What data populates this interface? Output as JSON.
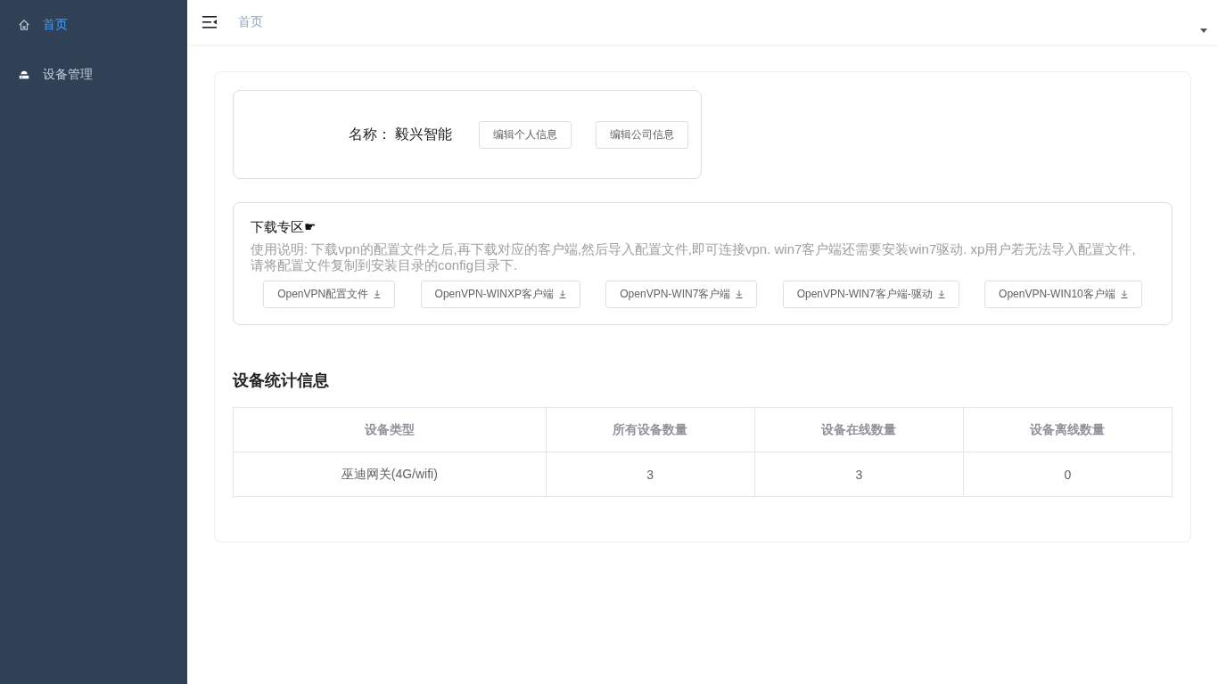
{
  "sidebar": {
    "items": [
      {
        "label": "首页",
        "selected": true
      },
      {
        "label": "设备管理",
        "selected": false
      }
    ]
  },
  "header": {
    "breadcrumb": "首页"
  },
  "profile": {
    "name_label": "名称：",
    "name": "毅兴智能",
    "buttons": [
      "编辑个人信息",
      "编辑公司信息"
    ]
  },
  "downloads": {
    "title": "下载专区☛",
    "description": "使用说明: 下载vpn的配置文件之后,再下载对应的客户端,然后导入配置文件,即可连接vpn. win7客户端还需要安装win7驱动. xp用户若无法导入配置文件,请将配置文件复制到安装目录的config目录下.",
    "buttons": [
      "OpenVPN配置文件",
      "OpenVPN-WINXP客户端",
      "OpenVPN-WIN7客户端",
      "OpenVPN-WIN7客户端-驱动",
      "OpenVPN-WIN10客户端"
    ]
  },
  "stats": {
    "title": "设备统计信息",
    "table": {
      "columns": [
        "设备类型",
        "所有设备数量",
        "设备在线数量",
        "设备离线数量"
      ],
      "rows": [
        [
          "巫迪网关(4G/wifi)",
          "3",
          "3",
          "0"
        ]
      ]
    }
  }
}
